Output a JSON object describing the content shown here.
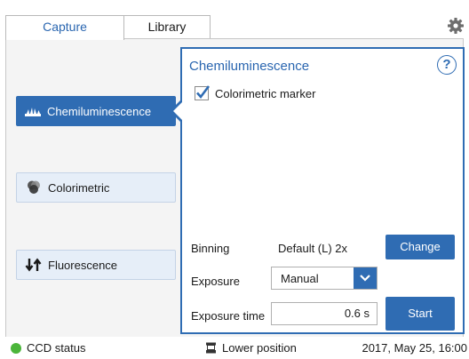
{
  "tabs": [
    {
      "label": "Capture",
      "active": true
    },
    {
      "label": "Library",
      "active": false
    }
  ],
  "settings_icon": "gear-icon",
  "modes": [
    {
      "label": "Chemiluminescence",
      "icon": "chemiluminescence-icon",
      "selected": true
    },
    {
      "label": "Colorimetric",
      "icon": "colorimetric-icon",
      "selected": false
    },
    {
      "label": "Fluorescence",
      "icon": "fluorescence-icon",
      "selected": false
    }
  ],
  "panel": {
    "title": "Chemiluminescence",
    "help_label": "?",
    "colorimetric_marker": {
      "label": "Colorimetric marker",
      "checked": true
    },
    "binning": {
      "label": "Binning",
      "value": "Default (L) 2x",
      "button": "Change"
    },
    "exposure": {
      "label": "Exposure",
      "selected": "Manual"
    },
    "exposure_time": {
      "label": "Exposure time",
      "value": "0.6 s"
    },
    "start_button": "Start"
  },
  "status": {
    "ccd": "CCD status",
    "ccd_color": "#4bb53a",
    "position": "Lower position",
    "datetime": "2017, May 25, 16:00"
  },
  "colors": {
    "accent": "#2f6cb3",
    "tab_active_text": "#2a66b0",
    "mode_inactive_bg": "#e6eef8"
  }
}
